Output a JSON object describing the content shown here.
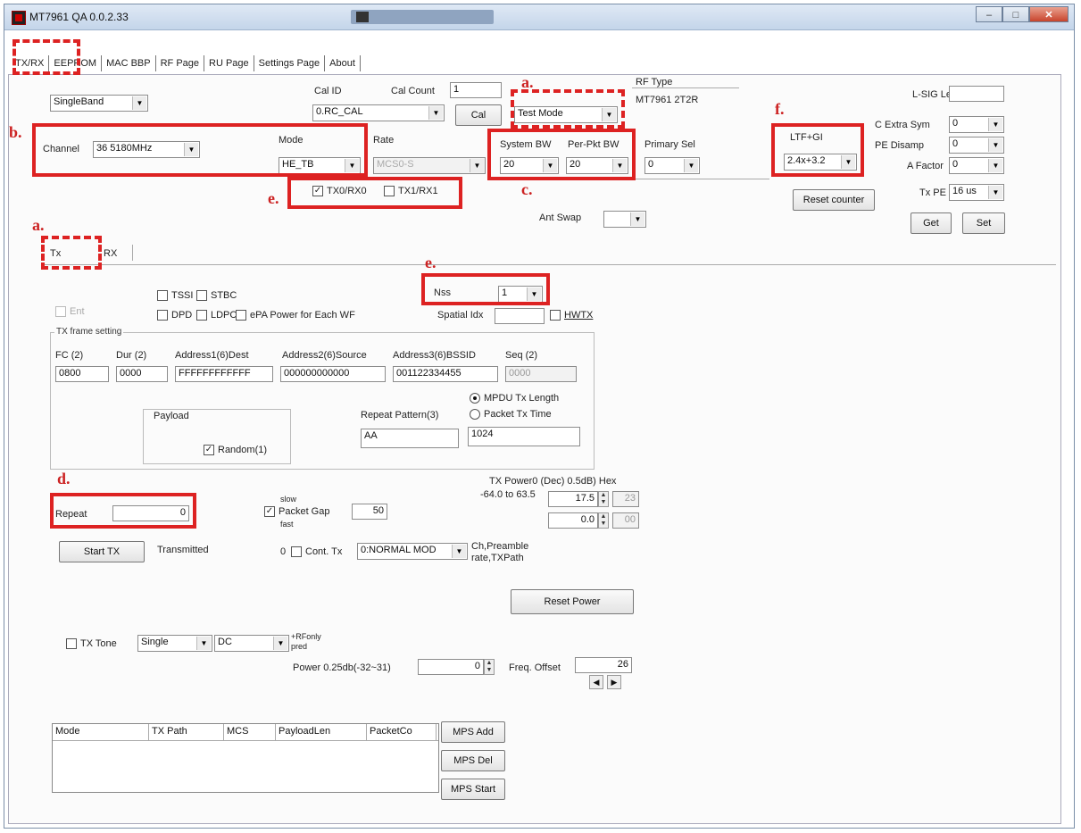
{
  "window": {
    "title": "MT7961 QA 0.0.2.33",
    "btn_min": "–",
    "btn_max": "□",
    "btn_close": "✕"
  },
  "tabs": [
    "TX/RX",
    "EEPROM",
    "MAC BBP",
    "RF Page",
    "RU Page",
    "Settings Page",
    "About"
  ],
  "top": {
    "band": "SingleBand",
    "cal_id_label": "Cal ID",
    "cal_id": "0.RC_CAL",
    "cal_count_label": "Cal Count",
    "cal_count": "1",
    "cal_button": "Cal",
    "test_mode": "Test Mode",
    "rf_type_label": "RF Type",
    "rf_type": "MT7961  2T2R",
    "lsig_label": "L-SIG Len",
    "channel_label": "Channel",
    "channel": "36  5180MHz",
    "mode_label": "Mode",
    "mode": "HE_TB",
    "rate_label": "Rate",
    "rate": "MCS0-S",
    "sys_bw_label": "System BW",
    "sys_bw": "20",
    "per_pkt_bw_label": "Per-Pkt BW",
    "per_pkt_bw": "20",
    "primary_sel_label": "Primary Sel",
    "primary_sel": "0",
    "ltf_gi_label": "LTF+GI",
    "ltf_gi": "2.4x+3.2",
    "extra_sym_label": "C Extra Sym",
    "extra_sym": "0",
    "pe_disamp_label": "PE Disamp",
    "pe_disamp": "0",
    "a_factor_label": "A Factor",
    "a_factor": "0",
    "tx_pe_label": "Tx PE",
    "tx_pe": "16 us",
    "get_button": "Get",
    "set_button": "Set",
    "reset_counter": "Reset counter",
    "tx0rx0": "TX0/RX0",
    "tx1rx1": "TX1/RX1",
    "ant_swap_label": "Ant Swap",
    "ant_swap": ""
  },
  "subtabs": {
    "tx": "Tx",
    "rx": "RX"
  },
  "tx": {
    "nss_label": "Nss",
    "nss": "1",
    "tssi": "TSSI",
    "stbc": "STBC",
    "dpd": "DPD",
    "ldpc": "LDPC",
    "epa": "ePA Power for Each WF",
    "spatial_label": "Spatial Idx",
    "hwtx": "HWTX",
    "dis_check": "Ent",
    "frame_group": "TX frame setting",
    "frame_headers": [
      "FC (2)",
      "Dur (2)",
      "Address1(6)Dest",
      "Address2(6)Source",
      "Address3(6)BSSID",
      "Seq (2)"
    ],
    "frame_values": [
      "0800",
      "0000",
      "FFFFFFFFFFFF",
      "000000000000",
      "001122334455",
      "0000"
    ],
    "payload_group": "Payload",
    "random": "Random(1)",
    "repeat_pattern_label": "Repeat Pattern(3)",
    "repeat_pattern": "AA",
    "mpdu_len": "MPDU Tx Length",
    "pkt_time": "Packet Tx Time",
    "len_value": "1024",
    "repeat_label": "Repeat",
    "repeat_value": "0",
    "packet_gap_top": "slow",
    "packet_gap": "Packet Gap",
    "packet_gap_bottom": "fast",
    "gap_value": "50",
    "txpower_title": "TX Power0 (Dec) 0.5dB) Hex",
    "txpower_range": "-64.0 to 63.5",
    "txp0_dec": "17.5",
    "txp0_hex": "23",
    "txp1_dec": "0.0",
    "txp1_hex": "00",
    "start_tx": "Start TX",
    "transmitted": "Transmitted",
    "cont_prefix": "0",
    "cont_tx": "Cont. Tx",
    "cont_mode": "0:NORMAL MOD",
    "ch_preamble": "Ch,Preamble",
    "rate_txpath": "rate,TXPath",
    "reset_power": "Reset Power",
    "tx_tone": "TX Tone",
    "tone_single": "Single",
    "tone_dc": "DC",
    "rf_only_1": "+RFonly",
    "rf_only_2": "pred",
    "power_label": "Power 0.25db(-32~31)",
    "power_value": "0",
    "freq_offset_label": "Freq. Offset",
    "freq_offset": "26"
  },
  "mps": {
    "headers": [
      "Mode",
      "TX Path",
      "MCS",
      "PayloadLen",
      "PacketCo"
    ],
    "add": "MPS Add",
    "del": "MPS Del",
    "start": "MPS Start"
  },
  "annotations": {
    "a": "a.",
    "b": "b.",
    "c": "c.",
    "d": "d.",
    "e": "e.",
    "f": "f."
  },
  "colors": {
    "highlight": "#dd2222",
    "title_bar": "#c4d5ea"
  }
}
